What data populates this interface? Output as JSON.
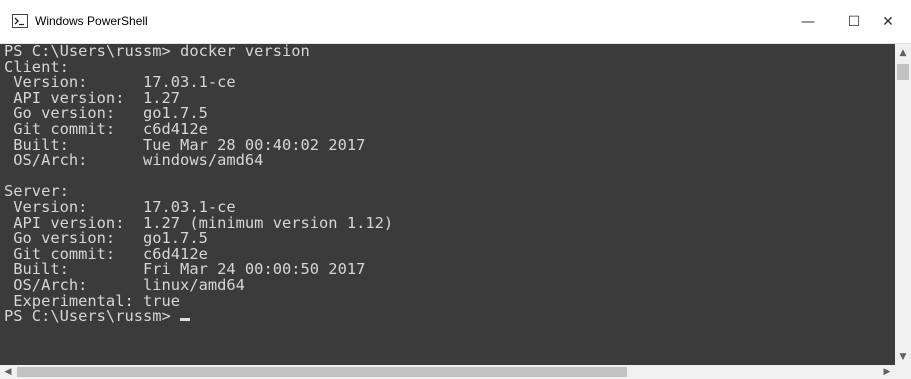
{
  "window": {
    "title": "Windows PowerShell",
    "icon": "powershell-icon",
    "controls": {
      "minimize": "—",
      "maximize": "☐",
      "close": "✕"
    }
  },
  "console": {
    "lines": [
      "PS C:\\Users\\russm> docker version",
      "Client:",
      " Version:      17.03.1-ce",
      " API version:  1.27",
      " Go version:   go1.7.5",
      " Git commit:   c6d412e",
      " Built:        Tue Mar 28 00:40:02 2017",
      " OS/Arch:      windows/amd64",
      "",
      "Server:",
      " Version:      17.03.1-ce",
      " API version:  1.27 (minimum version 1.12)",
      " Go version:   go1.7.5",
      " Git commit:   c6d412e",
      " Built:        Fri Mar 24 00:00:50 2017",
      " OS/Arch:      linux/amd64",
      " Experimental: true"
    ],
    "prompt": "PS C:\\Users\\russm> "
  },
  "scrollbars": {
    "up": "▲",
    "down": "▼",
    "left": "◀",
    "right": "▶"
  },
  "colors": {
    "terminal_bg": "#3b3b3b",
    "terminal_fg": "#d6d6d6"
  }
}
